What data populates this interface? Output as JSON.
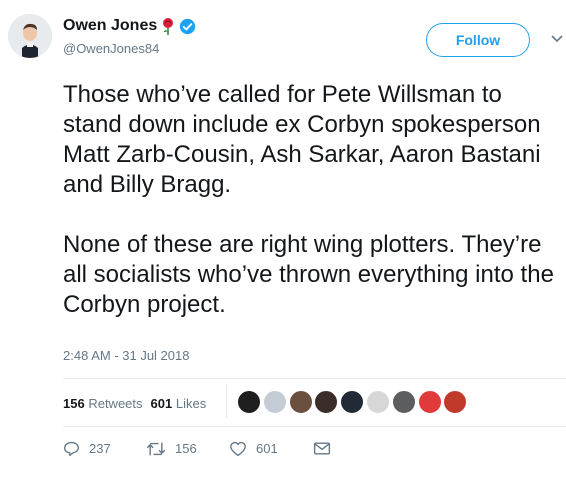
{
  "author": {
    "name": "Owen Jones",
    "handle": "@OwenJones84",
    "rose_icon": "red-rose-icon",
    "verified_icon": "verified-badge-icon"
  },
  "follow_label": "Follow",
  "tweet": {
    "paragraph1": "Those who’ve called for Pete Willsman to stand down include ex Corbyn spokesperson Matt Zarb-Cousin, Ash Sarkar, Aaron Bastani and Billy Bragg.",
    "paragraph2": "None of these are right wing plotters. They’re all socialists who’ve thrown everything into the Corbyn project."
  },
  "timestamp": "2:48 AM - 31 Jul 2018",
  "stats": {
    "retweets_count": "156",
    "retweets_label": "Retweets",
    "likes_count": "601",
    "likes_label": "Likes"
  },
  "actions": {
    "replies": "237",
    "retweets": "156",
    "likes": "601"
  },
  "colors": {
    "accent": "#1da1f2",
    "muted": "#657786",
    "text": "#14171a"
  }
}
